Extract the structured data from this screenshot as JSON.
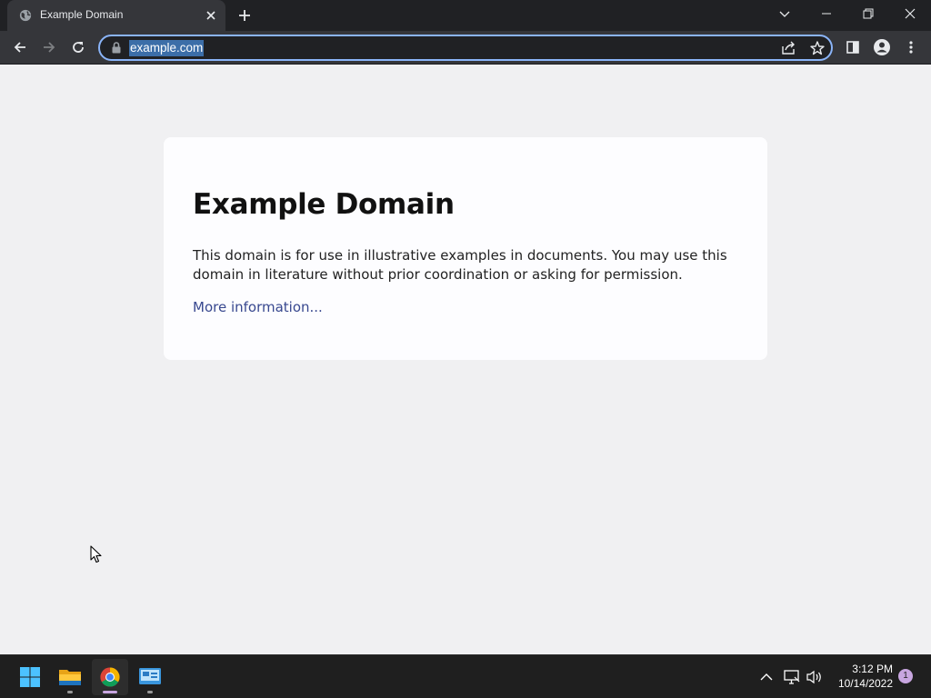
{
  "browser": {
    "tab": {
      "title": "Example Domain"
    },
    "omnibox": {
      "url": "example.com"
    }
  },
  "page": {
    "heading": "Example Domain",
    "body": "This domain is for use in illustrative examples in documents. You may use this domain in literature without prior coordination or asking for permission.",
    "link": "More information..."
  },
  "taskbar": {
    "apps": [
      "start-icon",
      "file-explorer-icon",
      "chrome-icon",
      "control-panel-icon"
    ],
    "time": "3:12 PM",
    "date": "10/14/2022",
    "notification_count": "1"
  },
  "colors": {
    "titlebar": "#202124",
    "toolbar": "#35363a",
    "omnibox_border": "#8ab4f8",
    "page_bg": "#f0f0f2",
    "card_bg": "#fdfdff",
    "link": "#38488f",
    "taskbar": "#1f1f1f"
  }
}
